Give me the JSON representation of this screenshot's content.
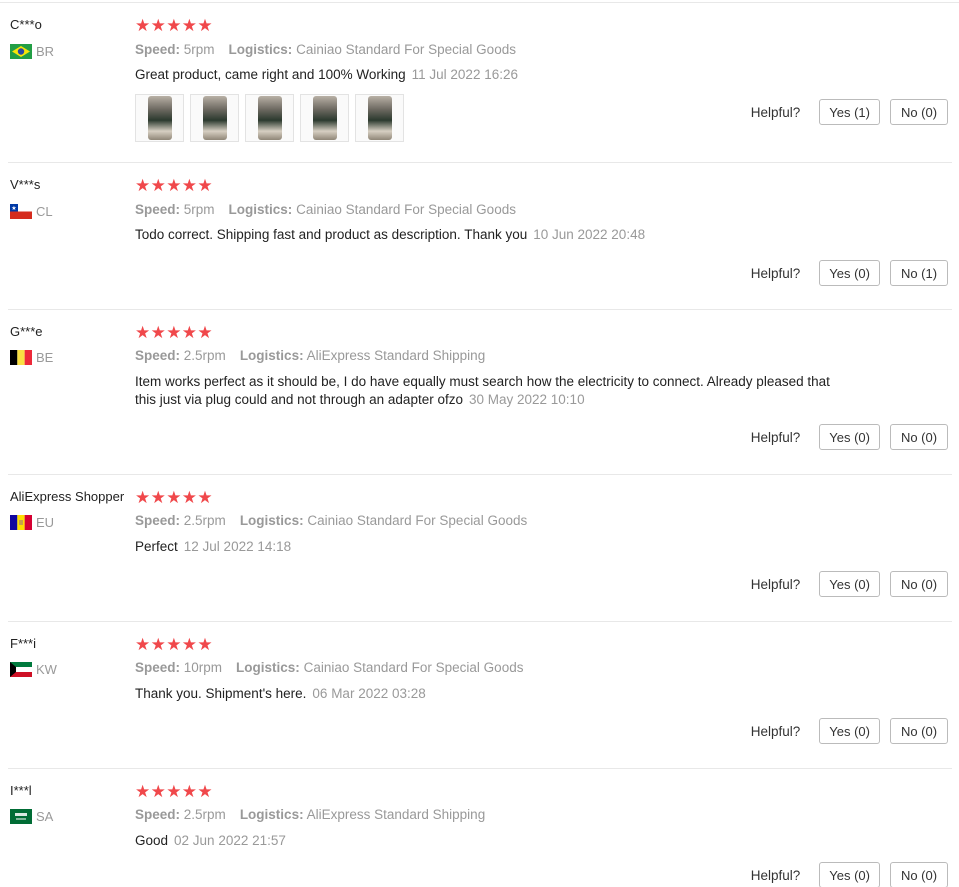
{
  "reviews": [
    {
      "user": "C***o",
      "country": "BR",
      "flag": "brazil-flag",
      "stars": 5,
      "speed_label": "Speed:",
      "speed": "5rpm",
      "logistics_label": "Logistics:",
      "logistics": "Cainiao Standard For Special Goods",
      "text": "Great product, came right and 100% Working",
      "date": "11 Jul 2022 16:26",
      "photos": 5,
      "helpful_label": "Helpful?",
      "yes": "Yes (1)",
      "no": "No (0)"
    },
    {
      "user": "V***s",
      "country": "CL",
      "flag": "chile-flag",
      "stars": 5,
      "speed_label": "Speed:",
      "speed": "5rpm",
      "logistics_label": "Logistics:",
      "logistics": "Cainiao Standard For Special Goods",
      "text": "Todo correct. Shipping fast and product as description. Thank you",
      "date": "10 Jun 2022 20:48",
      "helpful_label": "Helpful?",
      "yes": "Yes (0)",
      "no": "No (1)"
    },
    {
      "user": "G***e",
      "country": "BE",
      "flag": "belgium-flag",
      "stars": 5,
      "speed_label": "Speed:",
      "speed": "2.5rpm",
      "logistics_label": "Logistics:",
      "logistics": "AliExpress Standard Shipping",
      "text": "Item works perfect as it should be, I do have equally must search how the electricity to connect. Already pleased that this just via plug could and not through an adapter ofzo",
      "date": "30 May 2022 10:10",
      "helpful_label": "Helpful?",
      "yes": "Yes (0)",
      "no": "No (0)"
    },
    {
      "user": "AliExpress Shopper",
      "country": "EU",
      "flag": "andorra-flag",
      "stars": 5,
      "speed_label": "Speed:",
      "speed": "2.5rpm",
      "logistics_label": "Logistics:",
      "logistics": "Cainiao Standard For Special Goods",
      "text": "Perfect",
      "date": "12 Jul 2022 14:18",
      "helpful_label": "Helpful?",
      "yes": "Yes (0)",
      "no": "No (0)"
    },
    {
      "user": "F***i",
      "country": "KW",
      "flag": "kuwait-flag",
      "stars": 5,
      "speed_label": "Speed:",
      "speed": "10rpm",
      "logistics_label": "Logistics:",
      "logistics": "Cainiao Standard For Special Goods",
      "text": "Thank you. Shipment's here.",
      "date": "06 Mar 2022 03:28",
      "helpful_label": "Helpful?",
      "yes": "Yes (0)",
      "no": "No (0)"
    },
    {
      "user": "I***l",
      "country": "SA",
      "flag": "saudi-arabia-flag",
      "stars": 5,
      "speed_label": "Speed:",
      "speed": "2.5rpm",
      "logistics_label": "Logistics:",
      "logistics": "AliExpress Standard Shipping",
      "text": "Good",
      "date": "02 Jun 2022 21:57",
      "helpful_label": "Helpful?",
      "yes": "Yes (0)",
      "no": "No (0)"
    }
  ],
  "colors": {
    "star": "#f0484b",
    "muted": "#999999",
    "border": "#e8e8e8"
  }
}
